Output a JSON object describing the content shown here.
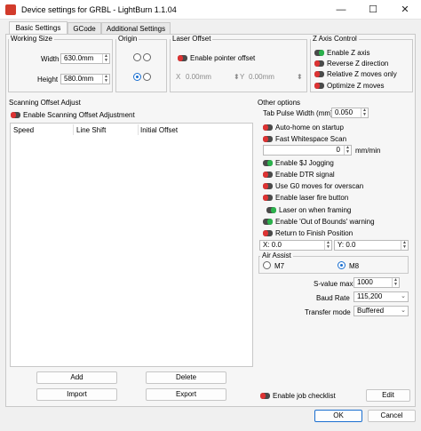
{
  "window": {
    "title": "Device settings for GRBL - LightBurn 1.1.04",
    "minimize": "—",
    "maximize": "☐",
    "close": "✕"
  },
  "tabs": [
    "Basic Settings",
    "GCode",
    "Additional Settings"
  ],
  "working_size": {
    "title": "Working Size",
    "width_label": "Width",
    "width_value": "630.0mm",
    "height_label": "Height",
    "height_value": "580.0mm"
  },
  "origin": {
    "title": "Origin"
  },
  "laser_offset": {
    "title": "Laser Offset",
    "enable_label": "Enable pointer offset",
    "x_label": "X",
    "x_value": "0.00mm",
    "y_label": "Y",
    "y_value": "0.00mm"
  },
  "z_axis": {
    "title": "Z Axis Control",
    "items": [
      "Enable Z axis",
      "Reverse Z direction",
      "Relative Z moves only",
      "Optimize Z moves"
    ]
  },
  "scanning": {
    "title": "Scanning Offset Adjust",
    "enable_label": "Enable Scanning Offset Adjustment",
    "columns": [
      "Speed",
      "Line Shift",
      "Initial Offset"
    ],
    "add": "Add",
    "delete": "Delete",
    "import": "Import",
    "export": "Export"
  },
  "other": {
    "title": "Other options",
    "tab_pulse_label": "Tab Pulse Width (mm)",
    "tab_pulse_value": "0.050",
    "auto_home": "Auto-home on startup",
    "fast_whitespace": "Fast Whitespace Scan",
    "speed_value": "0",
    "speed_unit": "mm/min",
    "jogging": "Enable $J Jogging",
    "dtr": "Enable DTR signal",
    "g0": "Use G0 moves for overscan",
    "fire": "Enable laser fire button",
    "laser_framing": "Laser on when framing",
    "oob": "Enable 'Out of Bounds' warning",
    "return_finish": "Return to Finish Position",
    "ret_x": "X: 0.0",
    "ret_y": "Y: 0.0",
    "air_assist_title": "Air Assist",
    "m7": "M7",
    "m8": "M8",
    "svalue_label": "S-value max",
    "svalue": "1000",
    "baud_label": "Baud Rate",
    "baud": "115,200",
    "transfer_label": "Transfer mode",
    "transfer": "Buffered",
    "job_checklist": "Enable job checklist",
    "edit": "Edit"
  },
  "footer": {
    "ok": "OK",
    "cancel": "Cancel"
  },
  "colors": {
    "toggle_on": "#2bb24c",
    "toggle_off": "#dd3333",
    "accent": "#1a6fd0"
  }
}
